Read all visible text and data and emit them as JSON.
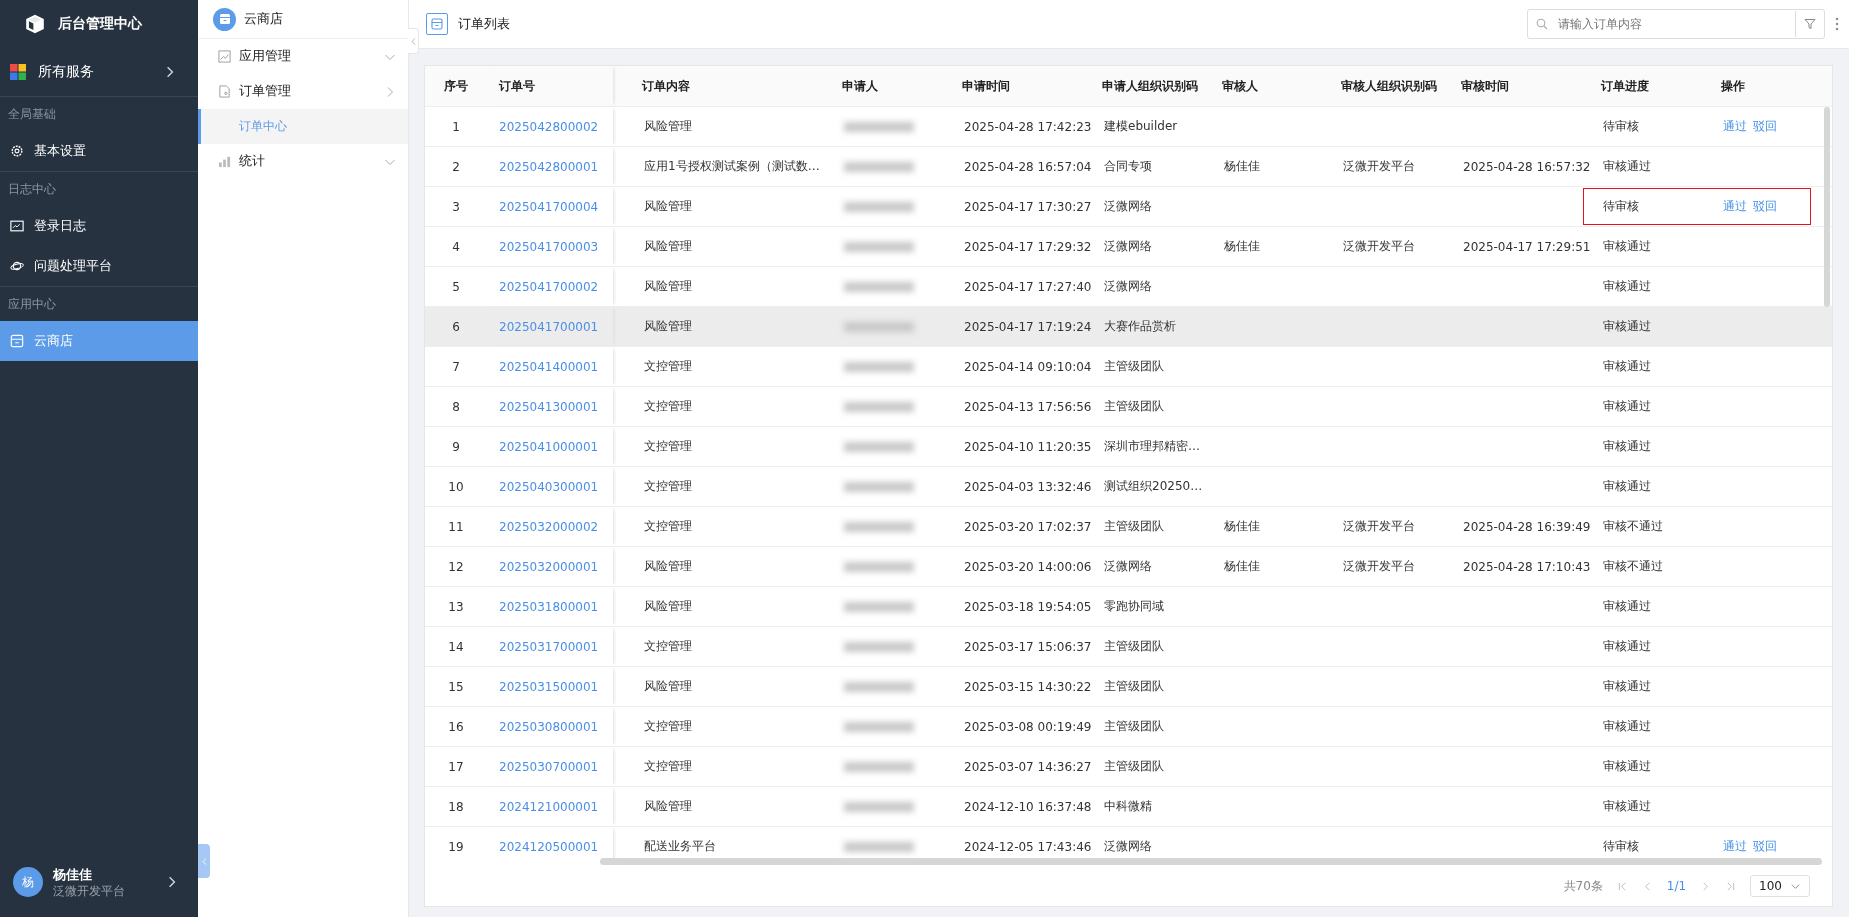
{
  "sidebar": {
    "title": "后台管理中心",
    "all_services": "所有服务",
    "sections": [
      {
        "label": "全局基础",
        "items": [
          {
            "kind": "gear",
            "label": "基本设置",
            "selected": false
          }
        ]
      },
      {
        "label": "日志中心",
        "items": [
          {
            "kind": "monitor",
            "label": "登录日志",
            "selected": false
          },
          {
            "kind": "planet",
            "label": "问题处理平台",
            "selected": false
          }
        ]
      },
      {
        "label": "应用中心",
        "items": [
          {
            "kind": "store",
            "label": "云商店",
            "selected": true
          }
        ]
      }
    ],
    "user": {
      "avatar": "杨",
      "name": "杨佳佳",
      "org": "泛微开发平台"
    }
  },
  "subnav": {
    "title": "云商店",
    "items": [
      {
        "kind": "image",
        "label": "应用管理",
        "expanded": false,
        "selected": false
      },
      {
        "kind": "doc",
        "label": "订单管理",
        "expanded": true,
        "selected": false,
        "children": [
          {
            "label": "订单中心",
            "selected": true
          }
        ]
      },
      {
        "kind": "chart",
        "label": "统计",
        "expanded": false,
        "selected": false
      }
    ]
  },
  "header": {
    "title": "订单列表",
    "search": {
      "placeholder": "请输入订单内容"
    }
  },
  "table": {
    "columns": [
      "序号",
      "订单号",
      "订单内容",
      "申请人",
      "申请时间",
      "申请人组织识别码",
      "审核人",
      "审核人组织识别码",
      "审核时间",
      "订单进度",
      "操作"
    ],
    "rows": [
      {
        "index": "1",
        "order_no": "2025042800002",
        "content": "风险管理",
        "apply_time": "2025-04-28 17:42:23",
        "applicant_org": "建模ebuilder",
        "reviewer": "",
        "reviewer_org": "",
        "review_time": "",
        "progress": "待审核",
        "actions": [
          "通过",
          "驳回"
        ],
        "hovered": false,
        "highlighted": false
      },
      {
        "index": "2",
        "order_no": "2025042800001",
        "content": "应用1号授权测试案例（测试数…",
        "apply_time": "2025-04-28 16:57:04",
        "applicant_org": "合同专项",
        "reviewer": "杨佳佳",
        "reviewer_org": "泛微开发平台",
        "review_time": "2025-04-28 16:57:32",
        "progress": "审核通过",
        "actions": [],
        "hovered": false,
        "highlighted": false
      },
      {
        "index": "3",
        "order_no": "2025041700004",
        "content": "风险管理",
        "apply_time": "2025-04-17 17:30:27",
        "applicant_org": "泛微网络",
        "reviewer": "",
        "reviewer_org": "",
        "review_time": "",
        "progress": "待审核",
        "actions": [
          "通过",
          "驳回"
        ],
        "hovered": false,
        "highlighted": true
      },
      {
        "index": "4",
        "order_no": "2025041700003",
        "content": "风险管理",
        "apply_time": "2025-04-17 17:29:32",
        "applicant_org": "泛微网络",
        "reviewer": "杨佳佳",
        "reviewer_org": "泛微开发平台",
        "review_time": "2025-04-17 17:29:51",
        "progress": "审核通过",
        "actions": [],
        "hovered": false,
        "highlighted": false
      },
      {
        "index": "5",
        "order_no": "2025041700002",
        "content": "风险管理",
        "apply_time": "2025-04-17 17:27:40",
        "applicant_org": "泛微网络",
        "reviewer": "",
        "reviewer_org": "",
        "review_time": "",
        "progress": "审核通过",
        "actions": [],
        "hovered": false,
        "highlighted": false
      },
      {
        "index": "6",
        "order_no": "2025041700001",
        "content": "风险管理",
        "apply_time": "2025-04-17 17:19:24",
        "applicant_org": "大赛作品赏析",
        "reviewer": "",
        "reviewer_org": "",
        "review_time": "",
        "progress": "审核通过",
        "actions": [],
        "hovered": true,
        "highlighted": false
      },
      {
        "index": "7",
        "order_no": "2025041400001",
        "content": "文控管理",
        "apply_time": "2025-04-14 09:10:04",
        "applicant_org": "主管级团队",
        "reviewer": "",
        "reviewer_org": "",
        "review_time": "",
        "progress": "审核通过",
        "actions": [],
        "hovered": false,
        "highlighted": false
      },
      {
        "index": "8",
        "order_no": "2025041300001",
        "content": "文控管理",
        "apply_time": "2025-04-13 17:56:56",
        "applicant_org": "主管级团队",
        "reviewer": "",
        "reviewer_org": "",
        "review_time": "",
        "progress": "审核通过",
        "actions": [],
        "hovered": false,
        "highlighted": false
      },
      {
        "index": "9",
        "order_no": "2025041000001",
        "content": "文控管理",
        "apply_time": "2025-04-10 11:20:35",
        "applicant_org": "深圳市理邦精密…",
        "reviewer": "",
        "reviewer_org": "",
        "review_time": "",
        "progress": "审核通过",
        "actions": [],
        "hovered": false,
        "highlighted": false
      },
      {
        "index": "10",
        "order_no": "2025040300001",
        "content": "文控管理",
        "apply_time": "2025-04-03 13:32:46",
        "applicant_org": "测试组织20250…",
        "reviewer": "",
        "reviewer_org": "",
        "review_time": "",
        "progress": "审核通过",
        "actions": [],
        "hovered": false,
        "highlighted": false
      },
      {
        "index": "11",
        "order_no": "2025032000002",
        "content": "文控管理",
        "apply_time": "2025-03-20 17:02:37",
        "applicant_org": "主管级团队",
        "reviewer": "杨佳佳",
        "reviewer_org": "泛微开发平台",
        "review_time": "2025-04-28 16:39:49",
        "progress": "审核不通过",
        "actions": [],
        "hovered": false,
        "highlighted": false
      },
      {
        "index": "12",
        "order_no": "2025032000001",
        "content": "风险管理",
        "apply_time": "2025-03-20 14:00:06",
        "applicant_org": "泛微网络",
        "reviewer": "杨佳佳",
        "reviewer_org": "泛微开发平台",
        "review_time": "2025-04-28 17:10:43",
        "progress": "审核不通过",
        "actions": [],
        "hovered": false,
        "highlighted": false
      },
      {
        "index": "13",
        "order_no": "2025031800001",
        "content": "风险管理",
        "apply_time": "2025-03-18 19:54:05",
        "applicant_org": "零跑协同域",
        "reviewer": "",
        "reviewer_org": "",
        "review_time": "",
        "progress": "审核通过",
        "actions": [],
        "hovered": false,
        "highlighted": false
      },
      {
        "index": "14",
        "order_no": "2025031700001",
        "content": "文控管理",
        "apply_time": "2025-03-17 15:06:37",
        "applicant_org": "主管级团队",
        "reviewer": "",
        "reviewer_org": "",
        "review_time": "",
        "progress": "审核通过",
        "actions": [],
        "hovered": false,
        "highlighted": false
      },
      {
        "index": "15",
        "order_no": "2025031500001",
        "content": "风险管理",
        "apply_time": "2025-03-15 14:30:22",
        "applicant_org": "主管级团队",
        "reviewer": "",
        "reviewer_org": "",
        "review_time": "",
        "progress": "审核通过",
        "actions": [],
        "hovered": false,
        "highlighted": false
      },
      {
        "index": "16",
        "order_no": "2025030800001",
        "content": "文控管理",
        "apply_time": "2025-03-08 00:19:49",
        "applicant_org": "主管级团队",
        "reviewer": "",
        "reviewer_org": "",
        "review_time": "",
        "progress": "审核通过",
        "actions": [],
        "hovered": false,
        "highlighted": false
      },
      {
        "index": "17",
        "order_no": "2025030700001",
        "content": "文控管理",
        "apply_time": "2025-03-07 14:36:27",
        "applicant_org": "主管级团队",
        "reviewer": "",
        "reviewer_org": "",
        "review_time": "",
        "progress": "审核通过",
        "actions": [],
        "hovered": false,
        "highlighted": false
      },
      {
        "index": "18",
        "order_no": "2024121000001",
        "content": "风险管理",
        "apply_time": "2024-12-10 16:37:48",
        "applicant_org": "中科微精",
        "reviewer": "",
        "reviewer_org": "",
        "review_time": "",
        "progress": "审核通过",
        "actions": [],
        "hovered": false,
        "highlighted": false
      },
      {
        "index": "19",
        "order_no": "2024120500001",
        "content": "配送业务平台",
        "apply_time": "2024-12-05 17:43:46",
        "applicant_org": "泛微网络",
        "reviewer": "",
        "reviewer_org": "",
        "review_time": "",
        "progress": "待审核",
        "actions": [
          "通过",
          "驳回"
        ],
        "hovered": false,
        "highlighted": false
      }
    ]
  },
  "pagination": {
    "total": "共70条",
    "page": "1/1",
    "page_size": "100"
  }
}
